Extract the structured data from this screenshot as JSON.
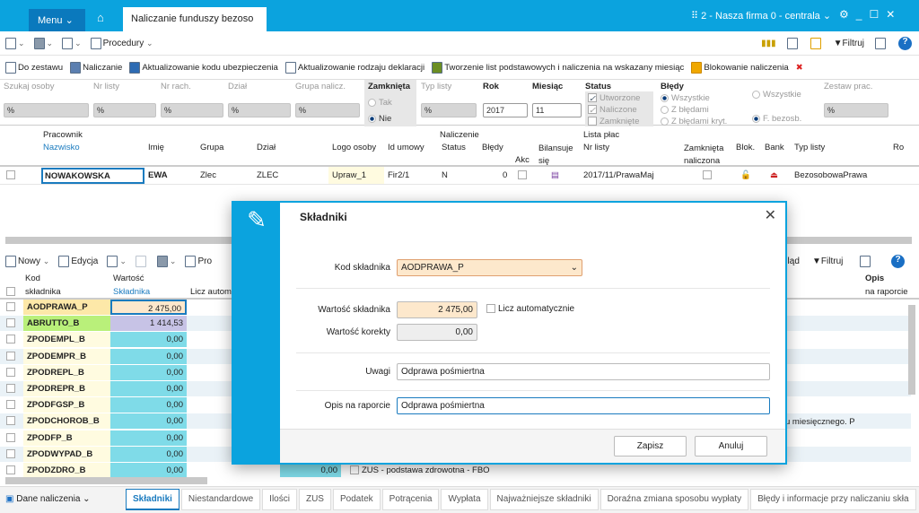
{
  "app": {
    "menu_label": "Menu",
    "tab_title": "Naliczanie funduszy bezoso",
    "firm": "2 - Nasza firma 0 - centrala"
  },
  "toolbar1": {
    "procedury": "Procedury",
    "filtruj": "Filtruj"
  },
  "toolbar2": [
    "Do zestawu",
    "Naliczanie",
    "Aktualizowanie kodu ubezpieczenia",
    "Aktualizowanie rodzaju deklaracji",
    "Tworzenie list podstawowych i naliczenia na wskazany miesiąc",
    "Blokowanie naliczenia"
  ],
  "filters": {
    "szukaj": "Szukaj osoby",
    "nr_listy": "Nr listy",
    "nr_rach": "Nr rach.",
    "dzial": "Dział",
    "grupa": "Grupa nalicz.",
    "zamknieta": "Zamknięta",
    "tak": "Tak",
    "nie": "Nie",
    "typ_listy": "Typ listy",
    "rok": "Rok",
    "rok_val": "2017",
    "miesiac": "Miesiąc",
    "miesiac_val": "11",
    "status": "Status",
    "utworzone": "Utworzone",
    "naliczone": "Naliczone",
    "zamkniete": "Zamknięte",
    "bledy": "Błędy",
    "wszystkie": "Wszystkie",
    "z_bledami": "Z błędami",
    "z_bledami_kryt": "Z błędami kryt.",
    "wszystkie2": "Wszystkie",
    "f_bezosb": "F. bezosb.",
    "zestaw": "Zestaw prac.",
    "pct": "%"
  },
  "grid1": {
    "groups": {
      "pracownik": "Pracownik",
      "naliczenie": "Naliczenie",
      "lista": "Lista płac"
    },
    "cols": {
      "nazwisko": "Nazwisko",
      "imie": "Imię",
      "grupa": "Grupa",
      "dzial": "Dział",
      "logo": "Logo osoby",
      "id_umowy": "Id umowy",
      "status": "Status",
      "bledy": "Błędy",
      "akc": "Akc",
      "bilansuje": "Bilansuje się",
      "nr_listy": "Nr listy",
      "zamknieta": "Zamknięta naliczona",
      "blok": "Blok.",
      "bank": "Bank",
      "typ": "Typ listy",
      "rok": "Rok"
    },
    "row": {
      "nazwisko": "NOWAKOWSKA",
      "imie": "EWA",
      "grupa": "Zlec",
      "dzial": "ZLEC",
      "logo": "Upraw_1",
      "id_umowy": "Fir2/1",
      "status": "N",
      "bledy": "0",
      "nr_listy": "2017/11/PrawaMaj",
      "typ": "BezosobowaPrawa"
    }
  },
  "toolbar3": {
    "nowy": "Nowy",
    "edycja": "Edycja",
    "pro": "Pro",
    "podglad": "gląd",
    "filtruj": "Filtruj"
  },
  "grid2": {
    "cols": {
      "kod1": "Kod",
      "kod2": "składnika",
      "wart1": "Wartość",
      "wart2": "Składnika",
      "licz": "Licz autom",
      "opis1": "Opis",
      "opis2": "na raporcie"
    },
    "rows": [
      {
        "kod": "AODPRAWA_P",
        "val": "2 475,00"
      },
      {
        "kod": "ABRUTTO_B",
        "val": "1 414,53"
      },
      {
        "kod": "ZPODEMPL_B",
        "val": "0,00"
      },
      {
        "kod": "ZPODEMPR_B",
        "val": "0,00"
      },
      {
        "kod": "ZPODREPL_B",
        "val": "0,00"
      },
      {
        "kod": "ZPODREPR_B",
        "val": "0,00"
      },
      {
        "kod": "ZPODFGSP_B",
        "val": "0,00"
      },
      {
        "kod": "ZPODCHOROB_B",
        "val": "0,00"
      },
      {
        "kod": "ZPODFP_B",
        "val": "0,00"
      },
      {
        "kod": "ZPODWYPAD_B",
        "val": "0,00"
      },
      {
        "kod": "ZPODZDRO_B",
        "val": "0,00"
      }
    ],
    "partial_opis": "u miesięcznego. P",
    "last_val2": "0,00",
    "last_desc": "ZUS - podstawa zdrowotna - FBO"
  },
  "bottom": {
    "dane": "Dane naliczenia",
    "tabs": [
      "Składniki",
      "Niestandardowe",
      "Ilości",
      "ZUS",
      "Podatek",
      "Potrącenia",
      "Wypłata",
      "Najważniejsze składniki",
      "Doraźna zmiana sposobu wypłaty",
      "Błędy i informacje przy naliczaniu skła"
    ]
  },
  "dialog": {
    "title": "Składniki",
    "kod_label": "Kod składnika",
    "kod_val": "AODPRAWA_P",
    "wart_label": "Wartość składnika",
    "wart_val": "2 475,00",
    "licz": "Licz automatycznie",
    "korekta_label": "Wartość korekty",
    "korekta_val": "0,00",
    "uwagi_label": "Uwagi",
    "uwagi_val": "Odprawa pośmiertna",
    "opis_label": "Opis na raporcie",
    "opis_val": "Odprawa pośmiertna",
    "save": "Zapisz",
    "cancel": "Anuluj"
  },
  "colors": {
    "accent": "#0ba3de",
    "menu": "#0a79bd",
    "value_cell": "#7fdbe8",
    "code_cell": "#fffbe0"
  }
}
